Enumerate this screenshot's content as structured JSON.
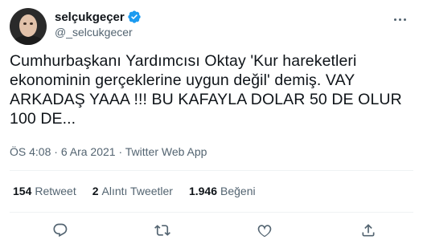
{
  "author": {
    "display_name": "selçukgeçer",
    "handle": "@_selcukgecer",
    "verified": true
  },
  "tweet": {
    "text_lines": [
      "Cumhurbaşkanı Yardımcısı Oktay 'Kur hareketleri",
      "ekonominin gerçeklerine uygun değil' demiş. VAY",
      "ARKADAŞ YAAA !!! BU KAFAYLA DOLAR 50 DE OLUR",
      "100 DE..."
    ],
    "time": "ÖS 4:08",
    "separator": "·",
    "date": "6 Ara 2021",
    "source": "Twitter Web App"
  },
  "stats": {
    "retweets": {
      "count": "154",
      "label": "Retweet"
    },
    "quotes": {
      "count": "2",
      "label": "Alıntı Tweetler"
    },
    "likes": {
      "count": "1.946",
      "label": "Beğeni"
    }
  },
  "icons": {
    "reply": "reply-icon",
    "retweet": "retweet-icon",
    "like": "heart-icon",
    "share": "share-icon",
    "more": "more-icon",
    "verified": "verified-badge-icon"
  },
  "colors": {
    "text": "#0f1419",
    "secondary": "#536471",
    "verified": "#1d9bf0",
    "divider": "#eff3f4"
  }
}
